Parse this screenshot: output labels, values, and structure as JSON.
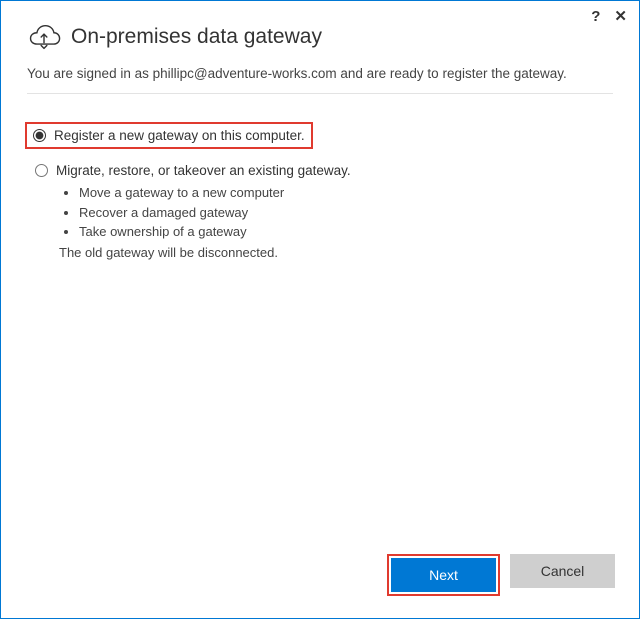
{
  "titlebar": {
    "help": "?",
    "close": "✕"
  },
  "header": {
    "title": "On-premises data gateway"
  },
  "signed_in": {
    "prefix": "You are signed in as ",
    "email": "phillipc@adventure-works.com",
    "suffix": " and are ready to register the gateway."
  },
  "options": {
    "register": {
      "label": "Register a new gateway on this computer.",
      "selected": true
    },
    "migrate": {
      "label": "Migrate, restore, or takeover an existing gateway.",
      "bullets": [
        "Move a gateway to a new computer",
        "Recover a damaged gateway",
        "Take ownership of a gateway"
      ],
      "note": "The old gateway will be disconnected.",
      "selected": false
    }
  },
  "footer": {
    "next": "Next",
    "cancel": "Cancel"
  }
}
